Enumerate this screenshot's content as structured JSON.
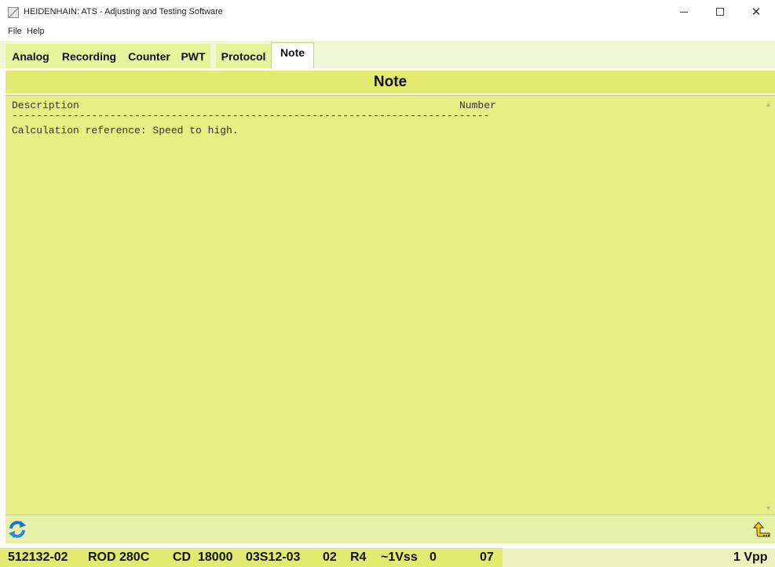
{
  "window": {
    "title": "HEIDENHAIN: ATS - Adjusting and Testing Software",
    "icon": "heidenhain-app-icon",
    "controls": [
      "minimize",
      "maximize",
      "close"
    ]
  },
  "menu": {
    "file": "File",
    "help": "Help"
  },
  "tabs": {
    "analog": "Analog",
    "recording": "Recording",
    "counter": "Counter",
    "pwt": "PWT",
    "protocol": "Protocol",
    "note": "Note",
    "active": "Note"
  },
  "header": {
    "title": "Note"
  },
  "table": {
    "col_description": "Description",
    "col_number": "Number",
    "separator": "------------------------------------------------------------------------------",
    "rows": [
      {
        "description": "Calculation reference: Speed to high.",
        "number": ""
      }
    ]
  },
  "toolbar": {
    "refresh_icon": "refresh-arrows-icon",
    "return_icon": "return-arrow-icon"
  },
  "status": {
    "id_number": "512132-02",
    "model": "ROD 280C",
    "cd": "CD",
    "line_count": "18000",
    "serial": "03S12-03",
    "code": "02",
    "r": "R4",
    "signal": "~1Vss",
    "zero": "0",
    "seven": "07",
    "interface": "1 Vpp"
  },
  "colors": {
    "accent_yellow": "#e2ea6f",
    "content_bg": "#e6ee84"
  }
}
